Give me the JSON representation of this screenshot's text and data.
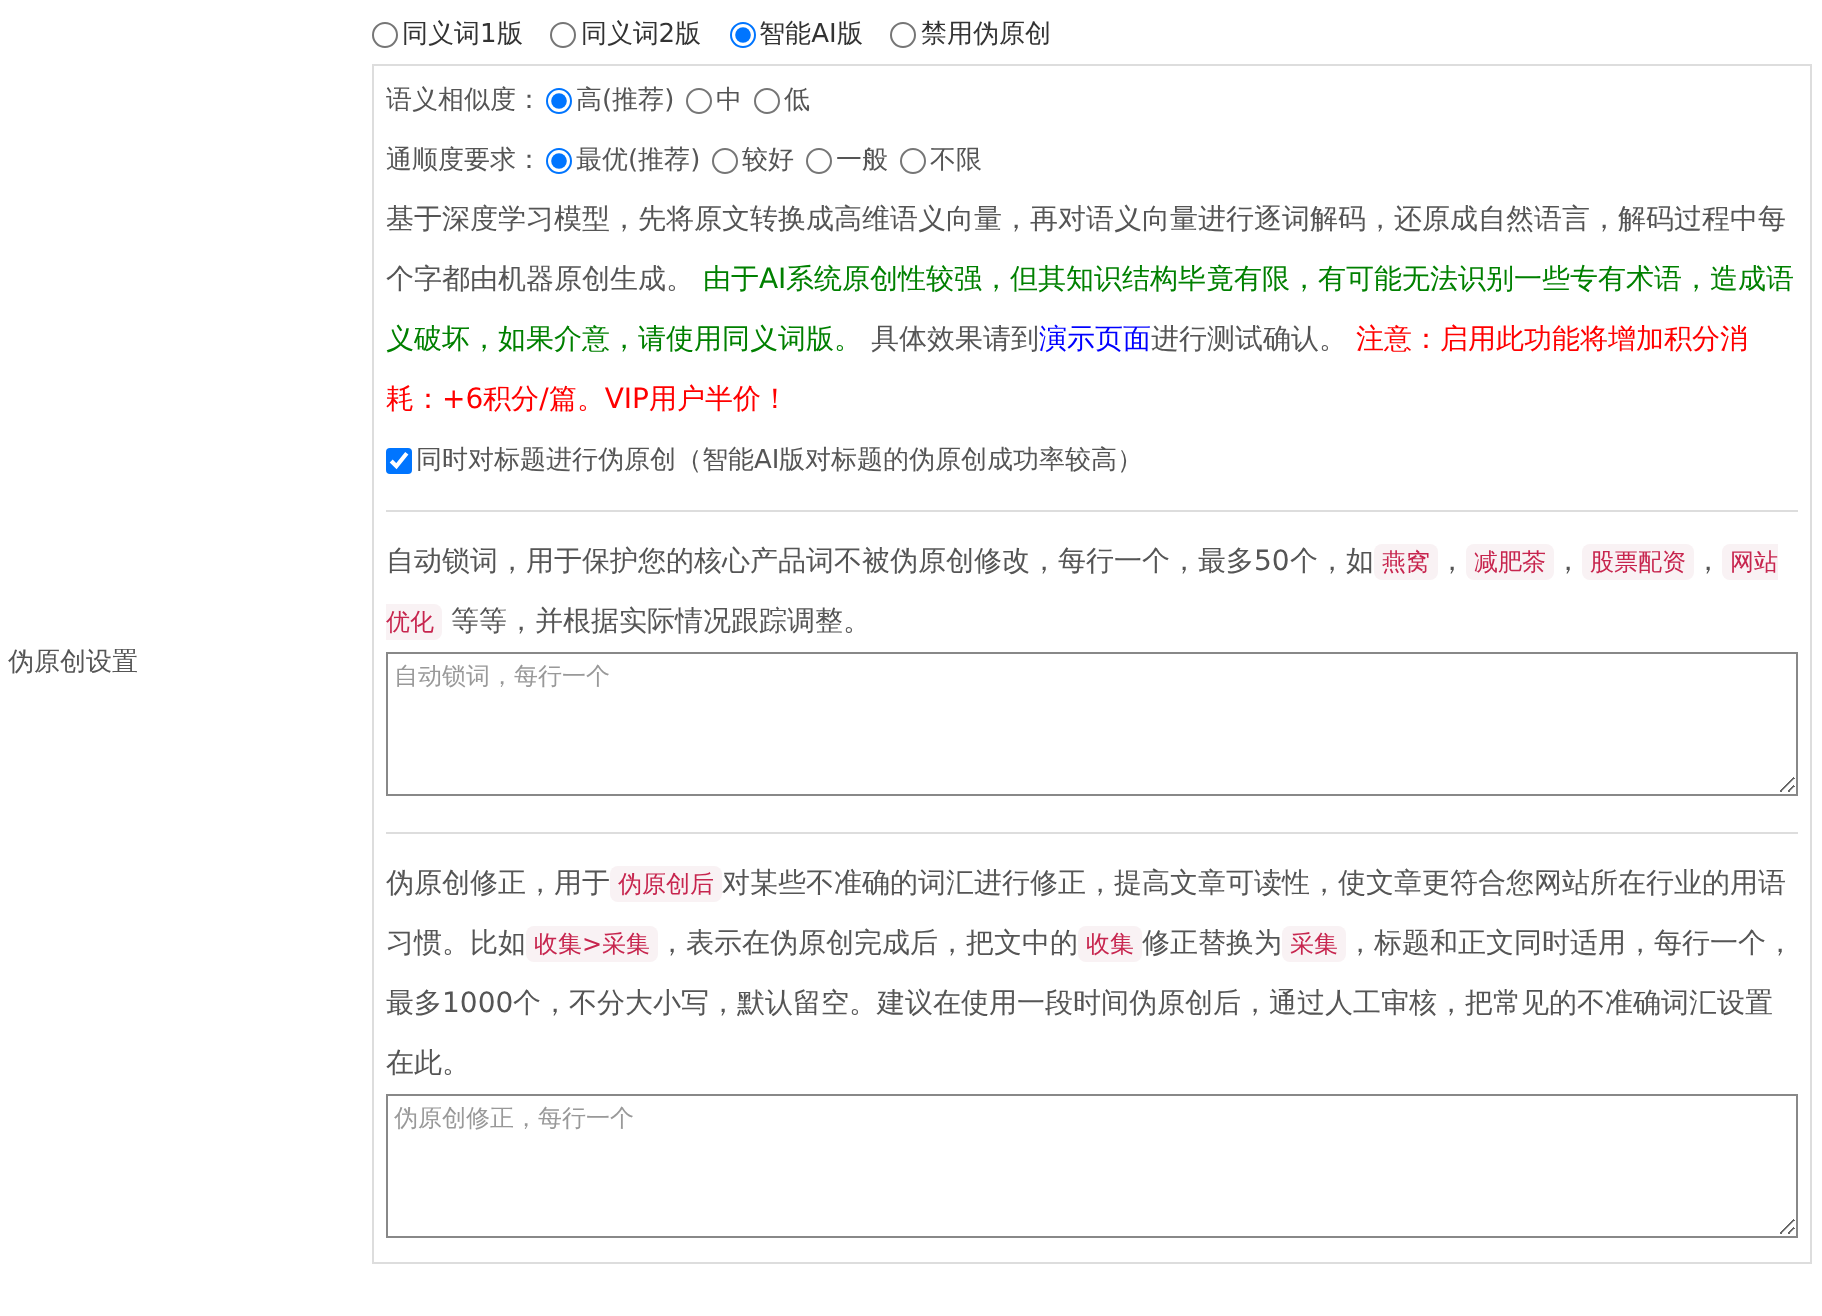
{
  "section_label": "伪原创设置",
  "modes": [
    {
      "label": "同义词1版",
      "selected": false
    },
    {
      "label": "同义词2版",
      "selected": false
    },
    {
      "label": "智能AI版",
      "selected": true
    },
    {
      "label": "禁用伪原创",
      "selected": false
    }
  ],
  "ai_panel": {
    "option_groups": [
      {
        "label": "语义相似度：",
        "options": [
          {
            "label": "高(推荐)",
            "selected": true
          },
          {
            "label": "中",
            "selected": false
          },
          {
            "label": "低",
            "selected": false
          }
        ]
      },
      {
        "label": "通顺度要求：",
        "options": [
          {
            "label": "最优(推荐)",
            "selected": true
          },
          {
            "label": "较好",
            "selected": false
          },
          {
            "label": "一般",
            "selected": false
          },
          {
            "label": "不限",
            "selected": false
          }
        ]
      }
    ],
    "description": [
      {
        "kind": "text",
        "text": "基于深度学习模型，先将原文转换成高维语义向量，再对语义向量进行逐词解码，还原成自然语言，解码过程中每个字都由机器原创生成。 "
      },
      {
        "kind": "caution",
        "text": "由于AI系统原创性较强，但其知识结构毕竟有限，有可能无法识别一些专有术语，造成语义破坏，如果介意，请使用同义词版。"
      },
      {
        "kind": "text",
        "text": " 具体效果请到"
      },
      {
        "kind": "link",
        "text": "演示页面"
      },
      {
        "kind": "text",
        "text": "进行测试确认。 "
      },
      {
        "kind": "alert",
        "text": "注意：启用此功能将增加积分消耗：+6积分/篇。VIP用户半价！"
      }
    ],
    "title_option": {
      "label": "同时对标题进行伪原创（智能AI版对标题的伪原创成功率较高）",
      "checked": true
    }
  },
  "lock_words": {
    "description": [
      {
        "kind": "text",
        "text": "自动锁词，用于保护您的核心产品词不被伪原创修改，每行一个，最多50个，如"
      },
      {
        "kind": "code",
        "text": "燕窝"
      },
      {
        "kind": "text",
        "text": "，"
      },
      {
        "kind": "code",
        "text": "减肥茶"
      },
      {
        "kind": "text",
        "text": "，"
      },
      {
        "kind": "code",
        "text": "股票配资"
      },
      {
        "kind": "text",
        "text": "，"
      },
      {
        "kind": "code",
        "text": "网站优化"
      },
      {
        "kind": "text",
        "text": " 等等，并根据实际情况跟踪调整。"
      }
    ],
    "placeholder": "自动锁词，每行一个"
  },
  "corrections": {
    "description": [
      {
        "kind": "text",
        "text": "伪原创修正，用于"
      },
      {
        "kind": "code",
        "text": "伪原创后"
      },
      {
        "kind": "text",
        "text": "对某些不准确的词汇进行修正，提高文章可读性，使文章更符合您网站所在行业的用语习惯。比如"
      },
      {
        "kind": "code",
        "text": "收集>采集"
      },
      {
        "kind": "text",
        "text": "，表示在伪原创完成后，把文中的"
      },
      {
        "kind": "code",
        "text": "收集"
      },
      {
        "kind": "text",
        "text": "修正替换为"
      },
      {
        "kind": "code",
        "text": "采集"
      },
      {
        "kind": "text",
        "text": "，标题和正文同时适用，每行一个，最多1000个，不分大小写，默认留空。建议在使用一段时间伪原创后，通过人工审核，把常见的不准确词汇设置在此。"
      }
    ],
    "placeholder": "伪原创修正，每行一个"
  }
}
